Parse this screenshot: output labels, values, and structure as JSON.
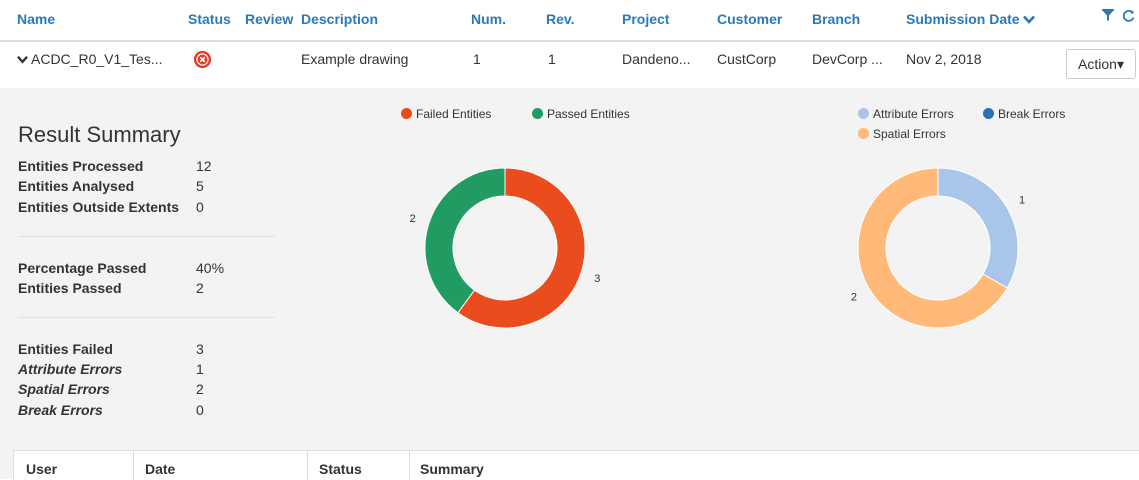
{
  "header": {
    "columns": {
      "name": "Name",
      "status": "Status",
      "review": "Review",
      "description": "Description",
      "num": "Num.",
      "rev": "Rev.",
      "project": "Project",
      "customer": "Customer",
      "branch": "Branch",
      "submission_date": "Submission Date"
    },
    "sort_icon": "chevron-down-icon",
    "tool_icons": [
      "filter-icon",
      "refresh-icon"
    ]
  },
  "row": {
    "expand_icon": "chevron-down-icon",
    "name": "ACDC_R0_V1_Tes...",
    "status_icon": "error-circle-icon",
    "status_color": "#e8381f",
    "description": "Example drawing",
    "num": "1",
    "rev": "1",
    "project": "Dandeno...",
    "customer": "CustCorp",
    "branch": "DevCorp ...",
    "submission_date": "Nov 2, 2018",
    "action_label": "Action▾"
  },
  "summary": {
    "title": "Result Summary",
    "group1": [
      {
        "label": "Entities Processed",
        "value": "12"
      },
      {
        "label": "Entities Analysed",
        "value": "5"
      },
      {
        "label": "Entities Outside Extents",
        "value": "0"
      }
    ],
    "group2": [
      {
        "label": "Percentage Passed",
        "value": "40%"
      },
      {
        "label": "Entities Passed",
        "value": "2"
      }
    ],
    "group3": [
      {
        "label": "Entities Failed",
        "value": "3"
      },
      {
        "label": "Attribute Errors",
        "value": "1"
      },
      {
        "label": "Spatial Errors",
        "value": "2"
      },
      {
        "label": "Break Errors",
        "value": "0"
      }
    ]
  },
  "chart_data": [
    {
      "type": "pie",
      "legend": "top",
      "series": [
        {
          "name": "Failed Entities",
          "value": 3,
          "color": "#ea4c1e"
        },
        {
          "name": "Passed Entities",
          "value": 2,
          "color": "#209b62"
        }
      ]
    },
    {
      "type": "pie",
      "legend": "top",
      "series": [
        {
          "name": "Attribute Errors",
          "value": 1,
          "color": "#a9c6ea"
        },
        {
          "name": "Break Errors",
          "value": 0,
          "color": "#2473b8"
        },
        {
          "name": "Spatial Errors",
          "value": 2,
          "color": "#ffba79"
        }
      ]
    }
  ],
  "history_table": {
    "columns": {
      "user": "User",
      "date": "Date",
      "status": "Status",
      "summary": "Summary"
    }
  }
}
